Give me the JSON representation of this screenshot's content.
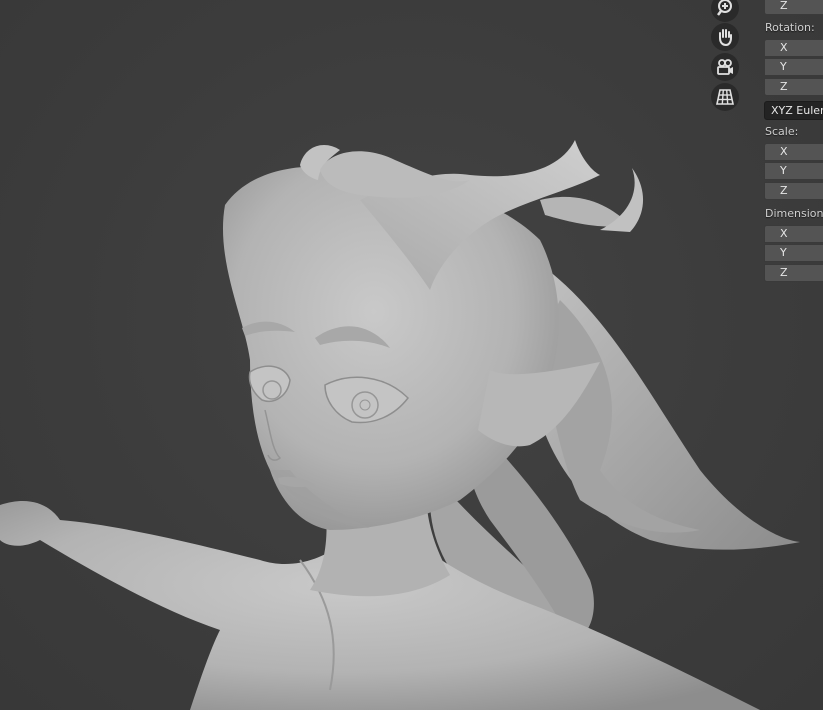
{
  "viewport": {
    "background": "#3d3d3d",
    "model_color": "#b9b9b9"
  },
  "nav_gizmo": [
    {
      "icon": "zoom-icon"
    },
    {
      "icon": "pan-hand-icon"
    },
    {
      "icon": "camera-view-icon"
    },
    {
      "icon": "orthographic-grid-icon"
    }
  ],
  "npanel": {
    "location": {
      "z": "Z"
    },
    "rotation": {
      "label": "Rotation:",
      "x": "X",
      "y": "Y",
      "z": "Z",
      "mode": "XYZ Euler"
    },
    "scale": {
      "label": "Scale:",
      "x": "X",
      "y": "Y",
      "z": "Z"
    },
    "dimensions": {
      "label": "Dimensions:",
      "x": "X",
      "y": "Y",
      "z": "Z"
    }
  }
}
